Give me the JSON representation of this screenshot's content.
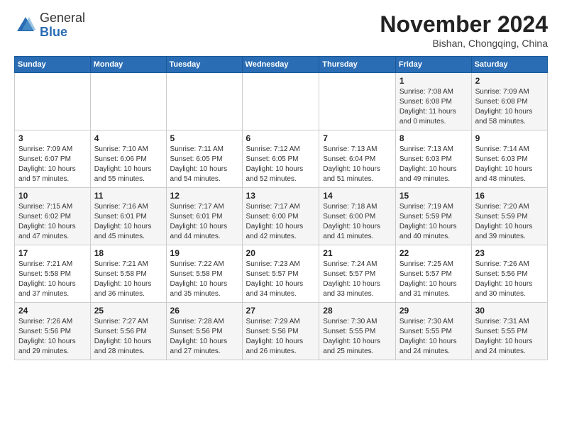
{
  "header": {
    "logo": {
      "general": "General",
      "blue": "Blue"
    },
    "title": "November 2024",
    "location": "Bishan, Chongqing, China"
  },
  "weekdays": [
    "Sunday",
    "Monday",
    "Tuesday",
    "Wednesday",
    "Thursday",
    "Friday",
    "Saturday"
  ],
  "weeks": [
    [
      {
        "day": null,
        "info": null
      },
      {
        "day": null,
        "info": null
      },
      {
        "day": null,
        "info": null
      },
      {
        "day": null,
        "info": null
      },
      {
        "day": null,
        "info": null
      },
      {
        "day": "1",
        "info": "Sunrise: 7:08 AM\nSunset: 6:08 PM\nDaylight: 11 hours\nand 0 minutes."
      },
      {
        "day": "2",
        "info": "Sunrise: 7:09 AM\nSunset: 6:08 PM\nDaylight: 10 hours\nand 58 minutes."
      }
    ],
    [
      {
        "day": "3",
        "info": "Sunrise: 7:09 AM\nSunset: 6:07 PM\nDaylight: 10 hours\nand 57 minutes."
      },
      {
        "day": "4",
        "info": "Sunrise: 7:10 AM\nSunset: 6:06 PM\nDaylight: 10 hours\nand 55 minutes."
      },
      {
        "day": "5",
        "info": "Sunrise: 7:11 AM\nSunset: 6:05 PM\nDaylight: 10 hours\nand 54 minutes."
      },
      {
        "day": "6",
        "info": "Sunrise: 7:12 AM\nSunset: 6:05 PM\nDaylight: 10 hours\nand 52 minutes."
      },
      {
        "day": "7",
        "info": "Sunrise: 7:13 AM\nSunset: 6:04 PM\nDaylight: 10 hours\nand 51 minutes."
      },
      {
        "day": "8",
        "info": "Sunrise: 7:13 AM\nSunset: 6:03 PM\nDaylight: 10 hours\nand 49 minutes."
      },
      {
        "day": "9",
        "info": "Sunrise: 7:14 AM\nSunset: 6:03 PM\nDaylight: 10 hours\nand 48 minutes."
      }
    ],
    [
      {
        "day": "10",
        "info": "Sunrise: 7:15 AM\nSunset: 6:02 PM\nDaylight: 10 hours\nand 47 minutes."
      },
      {
        "day": "11",
        "info": "Sunrise: 7:16 AM\nSunset: 6:01 PM\nDaylight: 10 hours\nand 45 minutes."
      },
      {
        "day": "12",
        "info": "Sunrise: 7:17 AM\nSunset: 6:01 PM\nDaylight: 10 hours\nand 44 minutes."
      },
      {
        "day": "13",
        "info": "Sunrise: 7:17 AM\nSunset: 6:00 PM\nDaylight: 10 hours\nand 42 minutes."
      },
      {
        "day": "14",
        "info": "Sunrise: 7:18 AM\nSunset: 6:00 PM\nDaylight: 10 hours\nand 41 minutes."
      },
      {
        "day": "15",
        "info": "Sunrise: 7:19 AM\nSunset: 5:59 PM\nDaylight: 10 hours\nand 40 minutes."
      },
      {
        "day": "16",
        "info": "Sunrise: 7:20 AM\nSunset: 5:59 PM\nDaylight: 10 hours\nand 39 minutes."
      }
    ],
    [
      {
        "day": "17",
        "info": "Sunrise: 7:21 AM\nSunset: 5:58 PM\nDaylight: 10 hours\nand 37 minutes."
      },
      {
        "day": "18",
        "info": "Sunrise: 7:21 AM\nSunset: 5:58 PM\nDaylight: 10 hours\nand 36 minutes."
      },
      {
        "day": "19",
        "info": "Sunrise: 7:22 AM\nSunset: 5:58 PM\nDaylight: 10 hours\nand 35 minutes."
      },
      {
        "day": "20",
        "info": "Sunrise: 7:23 AM\nSunset: 5:57 PM\nDaylight: 10 hours\nand 34 minutes."
      },
      {
        "day": "21",
        "info": "Sunrise: 7:24 AM\nSunset: 5:57 PM\nDaylight: 10 hours\nand 33 minutes."
      },
      {
        "day": "22",
        "info": "Sunrise: 7:25 AM\nSunset: 5:57 PM\nDaylight: 10 hours\nand 31 minutes."
      },
      {
        "day": "23",
        "info": "Sunrise: 7:26 AM\nSunset: 5:56 PM\nDaylight: 10 hours\nand 30 minutes."
      }
    ],
    [
      {
        "day": "24",
        "info": "Sunrise: 7:26 AM\nSunset: 5:56 PM\nDaylight: 10 hours\nand 29 minutes."
      },
      {
        "day": "25",
        "info": "Sunrise: 7:27 AM\nSunset: 5:56 PM\nDaylight: 10 hours\nand 28 minutes."
      },
      {
        "day": "26",
        "info": "Sunrise: 7:28 AM\nSunset: 5:56 PM\nDaylight: 10 hours\nand 27 minutes."
      },
      {
        "day": "27",
        "info": "Sunrise: 7:29 AM\nSunset: 5:56 PM\nDaylight: 10 hours\nand 26 minutes."
      },
      {
        "day": "28",
        "info": "Sunrise: 7:30 AM\nSunset: 5:55 PM\nDaylight: 10 hours\nand 25 minutes."
      },
      {
        "day": "29",
        "info": "Sunrise: 7:30 AM\nSunset: 5:55 PM\nDaylight: 10 hours\nand 24 minutes."
      },
      {
        "day": "30",
        "info": "Sunrise: 7:31 AM\nSunset: 5:55 PM\nDaylight: 10 hours\nand 24 minutes."
      }
    ]
  ]
}
